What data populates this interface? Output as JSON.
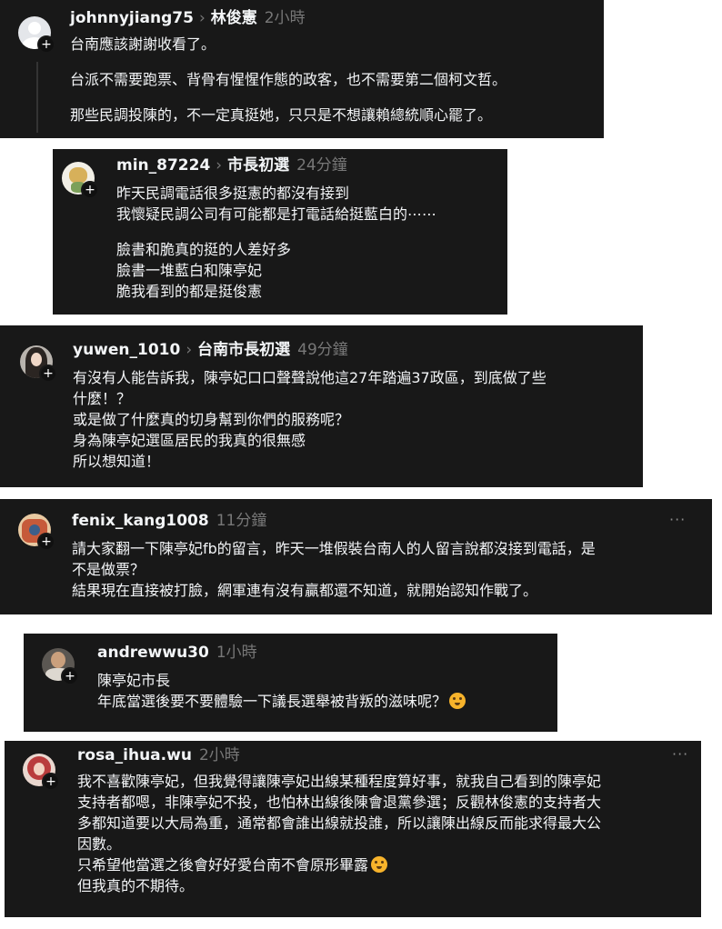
{
  "comments": [
    {
      "username": "johnnyjiang75",
      "reply_to": "林俊憲",
      "time": "2小時",
      "avatar_icon": "default-avatar-icon",
      "lines": [
        "台南應該謝謝收看了。",
        "台派不需要跑票、背骨有惺惺作態的政客，也不需要第二個柯文哲。",
        "那些民調投陳的，不一定真挺她，只只是不想讓賴總統順心罷了。"
      ]
    },
    {
      "username": "min_87224",
      "reply_to": "市長初選",
      "time": "24分鐘",
      "avatar_icon": "cat-avatar-icon",
      "lines": [
        "昨天民調電話很多挺憲的都沒有接到",
        "我懷疑民調公司有可能都是打電話給挺藍白的⋯⋯",
        "臉書和脆真的挺的人差好多",
        "臉書一堆藍白和陳亭妃",
        "脆我看到的都是挺俊憲"
      ]
    },
    {
      "username": "yuwen_1010",
      "reply_to": "台南市長初選",
      "time": "49分鐘",
      "avatar_icon": "girl-avatar-icon",
      "lines": [
        "有沒有人能告訴我，陳亭妃口口聲聲說他這27年踏遍37政區，到底做了些",
        "什麼！？",
        "或是做了什麼真的切身幫到你們的服務呢？",
        "身為陳亭妃選區居民的我真的很無感",
        "所以想知道！"
      ]
    },
    {
      "username": "fenix_kang1008",
      "time": "11分鐘",
      "more": "···",
      "avatar_icon": "art-avatar-icon",
      "lines": [
        "請大家翻一下陳亭妃fb的留言，昨天一堆假裝台南人的人留言說都沒接到電話，是",
        "不是做票？",
        "結果現在直接被打臉，網軍連有沒有贏都還不知道，就開始認知作戰了。"
      ]
    },
    {
      "username": "andrewwu30",
      "time": "1小時",
      "avatar_icon": "man-avatar-icon",
      "lines": [
        "陳亭妃市長",
        "年底當選後要不要體驗一下議長選舉被背叛的滋味呢？"
      ],
      "emoji": "hand-over-mouth-emoji"
    },
    {
      "username": "rosa_ihua.wu",
      "time": "2小時",
      "more": "···",
      "avatar_icon": "flower-avatar-icon",
      "lines": [
        "我不喜歡陳亭妃，但我覺得讓陳亭妃出線某種程度算好事，就我自己看到的陳亭妃",
        "支持者都嗯，非陳亭妃不投，也怕林出線後陳會退黨參選；反觀林俊憲的支持者大",
        "多都知道要以大局為重，通常都會誰出線就投誰，所以讓陳出線反而能求得最大公",
        "因數。",
        "只希望他當選之後會好好愛台南不會原形畢露",
        "但我真的不期待。"
      ],
      "emoji": "flushed-face-emoji"
    }
  ],
  "plus_glyph": "+"
}
